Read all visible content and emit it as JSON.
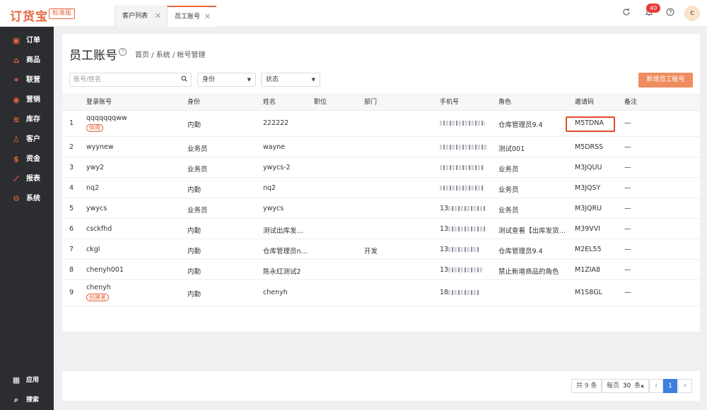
{
  "app": {
    "logo": "订货宝",
    "edition": "标准版"
  },
  "tabs": [
    {
      "label": "客户列表",
      "close": "✕"
    },
    {
      "label": "员工账号",
      "close": "✕"
    }
  ],
  "header": {
    "notification_count": "40",
    "avatar_letter": "c"
  },
  "sidebar": {
    "items": [
      {
        "label": "订单",
        "icon": "order-icon"
      },
      {
        "label": "商品",
        "icon": "goods-icon"
      },
      {
        "label": "联营",
        "icon": "alliance-icon"
      },
      {
        "label": "营销",
        "icon": "marketing-icon"
      },
      {
        "label": "库存",
        "icon": "inventory-icon"
      },
      {
        "label": "客户",
        "icon": "customer-icon"
      },
      {
        "label": "资金",
        "icon": "funds-icon"
      },
      {
        "label": "报表",
        "icon": "report-icon"
      },
      {
        "label": "系统",
        "icon": "system-icon"
      }
    ],
    "bottom": [
      {
        "label": "应用",
        "icon": "apps-icon"
      },
      {
        "label": "搜索",
        "icon": "search-icon"
      }
    ]
  },
  "page": {
    "title": "员工账号",
    "breadcrumb": "首页 / 系统 / 帐号管理",
    "search_placeholder": "账号/姓名",
    "filter_role": "身份",
    "filter_status": "状态",
    "add_button": "新增员工账号"
  },
  "table": {
    "columns": [
      "登录账号",
      "身份",
      "姓名",
      "职位",
      "部门",
      "手机号",
      "角色",
      "邀请码",
      "备注"
    ],
    "rows": [
      {
        "no": "1",
        "account": "qqqqqqqww",
        "tag": "停用",
        "identity": "内勤",
        "name": "222222",
        "position": "",
        "dept": "",
        "phone_prefix": "",
        "role": "仓库管理员9.4",
        "invite": "M5TDNA",
        "note": "—"
      },
      {
        "no": "2",
        "account": "wyynew",
        "tag": "",
        "identity": "业务员",
        "name": "wayne",
        "position": "",
        "dept": "",
        "phone_prefix": "",
        "role": "测试001",
        "invite": "M5DRSS",
        "note": "—"
      },
      {
        "no": "3",
        "account": "ywy2",
        "tag": "",
        "identity": "业务员",
        "name": "ywycs-2",
        "position": "",
        "dept": "",
        "phone_prefix": "",
        "role": "业务员",
        "invite": "M3JQUU",
        "note": "—"
      },
      {
        "no": "4",
        "account": "nq2",
        "tag": "",
        "identity": "内勤",
        "name": "nq2",
        "position": "",
        "dept": "",
        "phone_prefix": "",
        "role": "业务员",
        "invite": "M3JQSY",
        "note": "—"
      },
      {
        "no": "5",
        "account": "ywycs",
        "tag": "",
        "identity": "业务员",
        "name": "ywycs",
        "position": "",
        "dept": "",
        "phone_prefix": "13",
        "role": "业务员",
        "invite": "M3JQRU",
        "note": "—"
      },
      {
        "no": "6",
        "account": "csckfhd",
        "tag": "",
        "identity": "内勤",
        "name": "测试出库发…",
        "position": "",
        "dept": "",
        "phone_prefix": "13",
        "role": "测试查看【出库发货…",
        "invite": "M39VVI",
        "note": "—"
      },
      {
        "no": "7",
        "account": "ckgl",
        "tag": "",
        "identity": "内勤",
        "name": "仓库管理员n…",
        "position": "",
        "dept": "开发",
        "phone_prefix": "13",
        "role": "仓库管理员9.4",
        "invite": "M2EL55",
        "note": "—"
      },
      {
        "no": "8",
        "account": "chenyh001",
        "tag": "",
        "identity": "内勤",
        "name": "陈永红测试2",
        "position": "",
        "dept": "",
        "phone_prefix": "13",
        "role": "禁止新增商品的角色",
        "invite": "M1ZIA8",
        "note": "—"
      },
      {
        "no": "9",
        "account": "chenyh",
        "tag": "创建者",
        "identity": "内勤",
        "name": "chenyh",
        "position": "",
        "dept": "",
        "phone_prefix": "18",
        "role": "",
        "invite": "M1S8GL",
        "note": "—"
      }
    ]
  },
  "pagination": {
    "total": "共 9 条",
    "per_page_prefix": "每页",
    "per_page_value": "30",
    "per_page_suffix": "条▴",
    "prev": "‹",
    "current": "1",
    "next": "›"
  },
  "colors": {
    "accent": "#e8663d",
    "sidebar_bg": "#2b2d31",
    "primary_button": "#ef8d5f",
    "pager_active": "#3d7fe0"
  }
}
